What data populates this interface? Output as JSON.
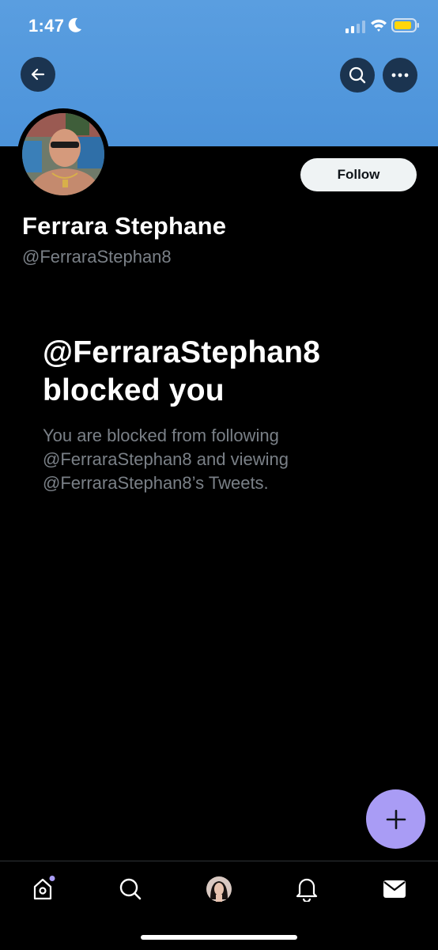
{
  "status_bar": {
    "time": "1:47"
  },
  "profile": {
    "follow_label": "Follow",
    "display_name": "Ferrara Stephane",
    "handle": "@FerraraStephan8"
  },
  "blocked": {
    "title_line1": "@FerraraStephan8",
    "title_line2": "blocked you",
    "body_line1": "You are blocked from following",
    "body_line2": "@FerraraStephan8 and viewing",
    "body_line3": "@FerraraStephan8’s Tweets."
  },
  "icons": {
    "back": "back-arrow-icon",
    "search": "search-icon",
    "more": "more-icon",
    "fab": "plus-icon",
    "tabs": [
      "home-icon",
      "search-icon",
      "profile-avatar",
      "bell-icon",
      "mail-icon"
    ]
  },
  "colors": {
    "banner": "#4c93da",
    "fab": "#a99cf5",
    "secondary_text": "#7a8087",
    "notification_dot": "#a99cf5"
  }
}
